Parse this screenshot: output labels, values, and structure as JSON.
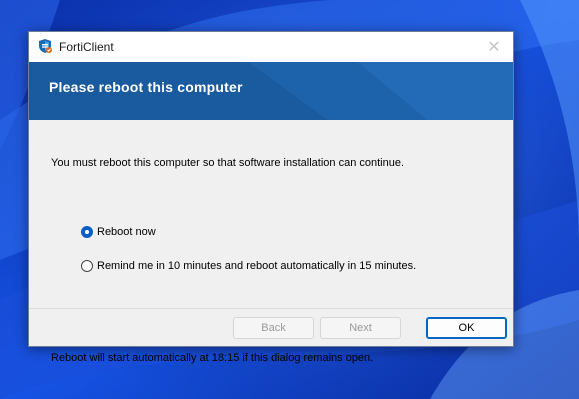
{
  "window": {
    "title": "FortiClient",
    "close_glyph": "✕"
  },
  "banner": {
    "title": "Please reboot this computer"
  },
  "content": {
    "message": "You must reboot this computer so that software installation can continue.",
    "options": [
      {
        "label": "Reboot now",
        "selected": true
      },
      {
        "label": "Remind me in 10 minutes and reboot automatically in 15 minutes.",
        "selected": false
      }
    ],
    "auto_note": "Reboot will start automatically at 18:15 if this dialog remains open."
  },
  "buttons": {
    "back_label": "Back",
    "next_label": "Next",
    "ok_label": "OK"
  },
  "icons": {
    "app": "forticlient-shield-icon",
    "close": "close-icon"
  },
  "colors": {
    "banner": "#1d5fa4",
    "accent": "#0067c0",
    "wallpaper": "#0a35b8"
  }
}
